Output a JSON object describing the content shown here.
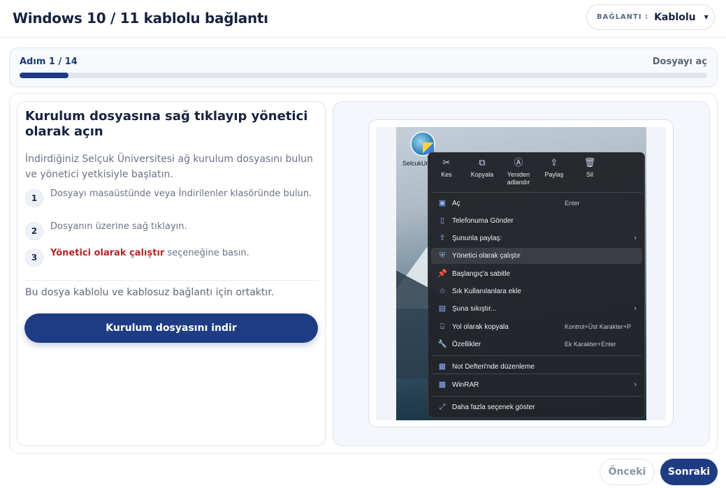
{
  "header": {
    "title": "Windows 10 / 11 kablolu bağlantı",
    "connection_label": "BAĞLANTI :",
    "connection_value": "Kablolu"
  },
  "progress": {
    "step_label": "Adım 1 / 14",
    "action_label": "Dosyayı aç",
    "fraction": 0.0714,
    "accent_color": "#1e3c84"
  },
  "instructions": {
    "title": "Kurulum dosyasına sağ tıklayıp yönetici olarak açın",
    "description": "İndirdiğiniz Selçuk Üniversitesi ağ kurulum dosyasını bulun ve yönetici yetkisiyle başlatın.",
    "steps": [
      {
        "num": "1",
        "text": "Dosyayı masaüstünde veya İndirilenler klasöründe bulun."
      },
      {
        "num": "2",
        "text": "Dosyanın üzerine sağ tıklayın."
      },
      {
        "num": "3",
        "highlight": "Yönetici olarak çalıştır",
        "text": " seçeneğine basın."
      }
    ],
    "note": "Bu dosya kablolu ve kablosuz bağlantı için ortaktır.",
    "download_button": "Kurulum dosyasını indir"
  },
  "screenshot": {
    "desktop_icon_label": "SelcukUni",
    "context_menu": {
      "top_actions": [
        {
          "icon": "scissors-icon",
          "glyph": "✂",
          "label": "Kes"
        },
        {
          "icon": "copy-icon",
          "glyph": "⧉",
          "label": "Kopyala"
        },
        {
          "icon": "rename-icon",
          "glyph": "Ⓐ",
          "label": "Yeniden adlandır"
        },
        {
          "icon": "share-icon",
          "glyph": "⇪",
          "label": "Paylaş"
        },
        {
          "icon": "trash-icon",
          "glyph": "🗑",
          "label": "Sil"
        }
      ],
      "items": [
        {
          "icon": "open-icon",
          "glyph": "▣",
          "label": "Aç",
          "shortcut": "Enter"
        },
        {
          "icon": "phone-icon",
          "glyph": "▯",
          "label": "Telefonuma Gönder"
        },
        {
          "icon": "share-with-icon",
          "glyph": "⇪",
          "label": "Şununla paylaş:",
          "arrow": "›"
        },
        {
          "icon": "shield-icon",
          "glyph": "⛨",
          "label": "Yönetici olarak çalıştır",
          "active": true
        },
        {
          "icon": "pin-icon",
          "glyph": "📌",
          "label": "Başlangıç'a sabitle"
        },
        {
          "icon": "star-icon",
          "glyph": "☆",
          "label": "Sık Kullanılanlara ekle"
        },
        {
          "icon": "compress-icon",
          "glyph": "▤",
          "label": "Şuna sıkıştır...",
          "arrow": "›"
        },
        {
          "icon": "path-icon",
          "glyph": "⌸",
          "label": "Yol olarak kopyala",
          "shortcut": "Kontrol+Üst Karakter+P"
        },
        {
          "icon": "wrench-icon",
          "glyph": "🔧",
          "label": "Özellikler",
          "shortcut": "Ek Karakter+Enter"
        },
        {
          "icon": "notepad-icon",
          "glyph": "▦",
          "label": "Not Defteri'nde düzenleme"
        },
        {
          "icon": "winrar-icon",
          "glyph": "▩",
          "label": "WinRAR",
          "arrow": "›"
        },
        {
          "icon": "more-options-icon",
          "glyph": "⤢",
          "label": "Daha fazla seçenek göster"
        }
      ]
    }
  },
  "footer": {
    "prev_label": "Önceki",
    "next_label": "Sonraki"
  }
}
